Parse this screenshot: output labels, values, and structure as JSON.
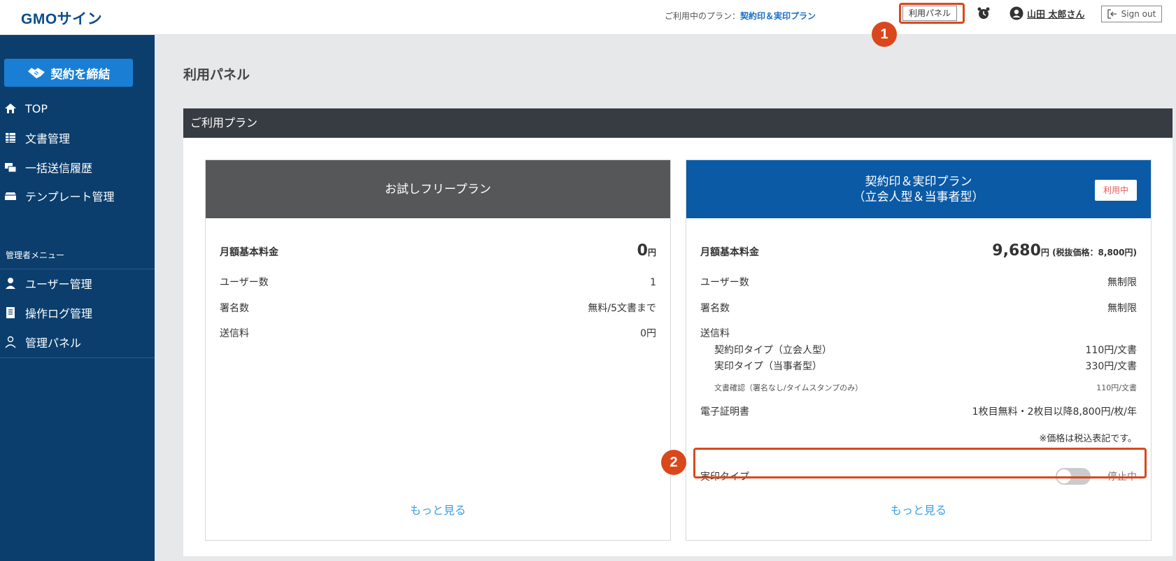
{
  "header": {
    "logo": "GMOサイン",
    "plan_prefix": "ご利用中のプラン：",
    "plan_name": "契約印＆実印プラン",
    "usage_panel_button": "利用パネル",
    "user_name": "山田 太郎さん",
    "signout_label": "Sign out"
  },
  "callouts": {
    "one": "1",
    "two": "2",
    "color": "#d9481c"
  },
  "sidebar": {
    "contract_button": "契約を締結",
    "items": [
      {
        "label": "TOP",
        "icon": "home-icon"
      },
      {
        "label": "文書管理",
        "icon": "document-list-icon"
      },
      {
        "label": "一括送信履歴",
        "icon": "bulk-send-icon"
      },
      {
        "label": "テンプレート管理",
        "icon": "template-icon"
      }
    ],
    "admin_label": "管理者メニュー",
    "admin_items": [
      {
        "label": "ユーザー管理",
        "icon": "user-icon"
      },
      {
        "label": "操作ログ管理",
        "icon": "log-icon"
      },
      {
        "label": "管理パネル",
        "icon": "admin-panel-icon"
      }
    ]
  },
  "main": {
    "page_title": "利用パネル",
    "panel_title": "ご利用プラン",
    "free_plan": {
      "title": "お試しフリープラン",
      "monthly_label": "月額基本料金",
      "monthly_value": "0",
      "monthly_unit": "円",
      "users_label": "ユーザー数",
      "users_value": "1",
      "signatures_label": "署名数",
      "signatures_value": "無料/5文書まで",
      "fee_label": "送信料",
      "fee_value": "0円",
      "more_link": "もっと見る"
    },
    "paid_plan": {
      "title_line1": "契約印＆実印プラン",
      "title_line2": "（立会人型＆当事者型）",
      "active_badge": "利用中",
      "monthly_label": "月額基本料金",
      "monthly_value": "9,680",
      "monthly_unit": "円 (税抜価格：8,800円)",
      "users_label": "ユーザー数",
      "users_value": "無制限",
      "signatures_label": "署名数",
      "signatures_value": "無制限",
      "fee_label": "送信料",
      "fee_items": [
        {
          "label": "契約印タイプ（立会人型）",
          "value": "110円/文書"
        },
        {
          "label": "実印タイプ（当事者型）",
          "value": "330円/文書"
        }
      ],
      "confirm_label": "文書確認（署名なし/タイムスタンプのみ）",
      "confirm_value": "110円/文書",
      "cert_label": "電子証明書",
      "cert_value": "1枚目無料・2枚目以降8,800円/枚/年",
      "tax_note": "※価格は税込表記です。",
      "toggle_label": "実印タイプ",
      "toggle_state": "停止中",
      "toggle_on": false,
      "more_link": "もっと見る"
    }
  }
}
